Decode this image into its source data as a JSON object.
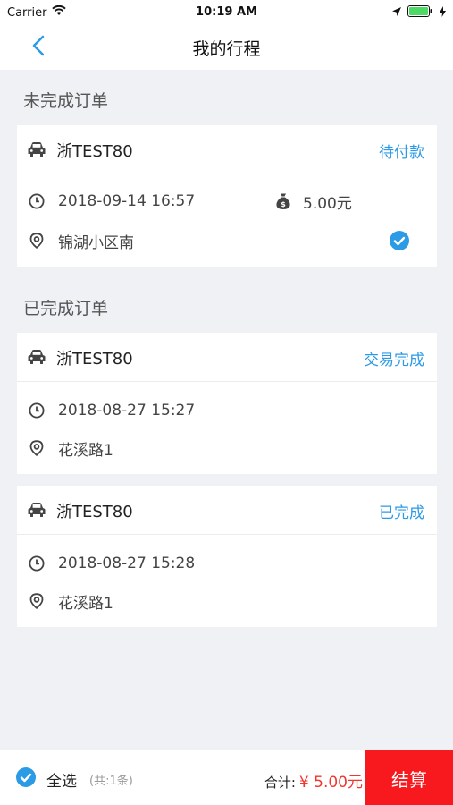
{
  "status_bar": {
    "carrier": "Carrier",
    "time": "10:19 AM"
  },
  "nav": {
    "title": "我的行程"
  },
  "unfinished": {
    "section_title": "未完成订单",
    "orders": [
      {
        "plate": "浙TEST80",
        "status": "待付款",
        "datetime": "2018-09-14 16:57",
        "amount": "5.00元",
        "location": "锦湖小区南",
        "selected": true
      }
    ]
  },
  "finished": {
    "section_title": "已完成订单",
    "orders": [
      {
        "plate": "浙TEST80",
        "status": "交易完成",
        "datetime": "2018-08-27 15:27",
        "location": "花溪路1"
      },
      {
        "plate": "浙TEST80",
        "status": "已完成",
        "datetime": "2018-08-27 15:28",
        "location": "花溪路1"
      }
    ]
  },
  "bottom_bar": {
    "select_all_label": "全选",
    "count_label": "(共:1条)",
    "total_label": "合计:",
    "total_value": "¥ 5.00元",
    "checkout_label": "结算"
  },
  "colors": {
    "accent": "#2c9be6",
    "checkout_bg": "#f7191d",
    "price": "#f0362f",
    "background": "#f0f1f4"
  },
  "icons": [
    "wifi-icon",
    "location-arrow-icon",
    "battery-icon",
    "back-chevron-icon",
    "car-icon",
    "clock-icon",
    "money-bag-icon",
    "location-pin-icon",
    "check-circle-icon"
  ]
}
